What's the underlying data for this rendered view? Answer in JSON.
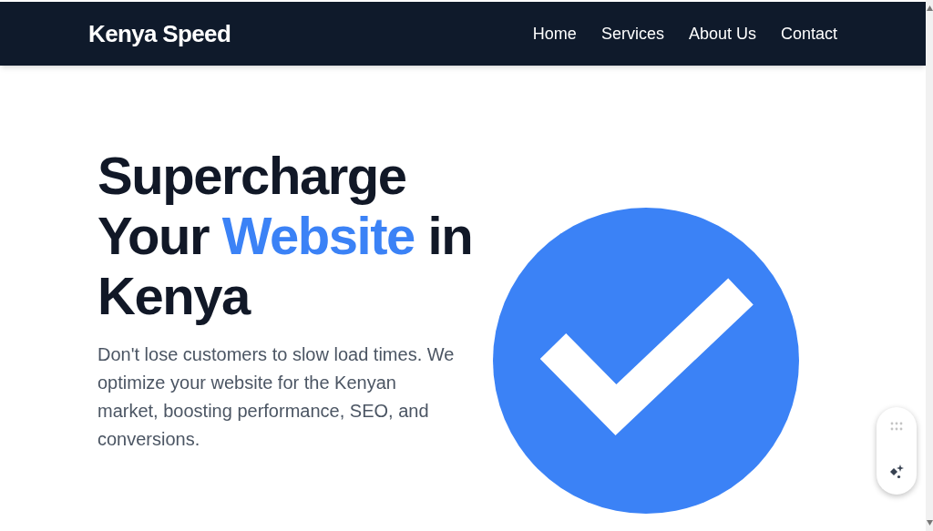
{
  "header": {
    "brand": "Kenya Speed",
    "nav": [
      {
        "label": "Home"
      },
      {
        "label": "Services"
      },
      {
        "label": "About Us"
      },
      {
        "label": "Contact"
      }
    ]
  },
  "hero": {
    "heading_before": "Supercharge Your",
    "heading_highlight": "Website",
    "heading_after": "in Kenya",
    "description": "Don't lose customers to slow load times. We optimize your website for the Kenyan market, boosting performance, SEO, and conversions."
  }
}
